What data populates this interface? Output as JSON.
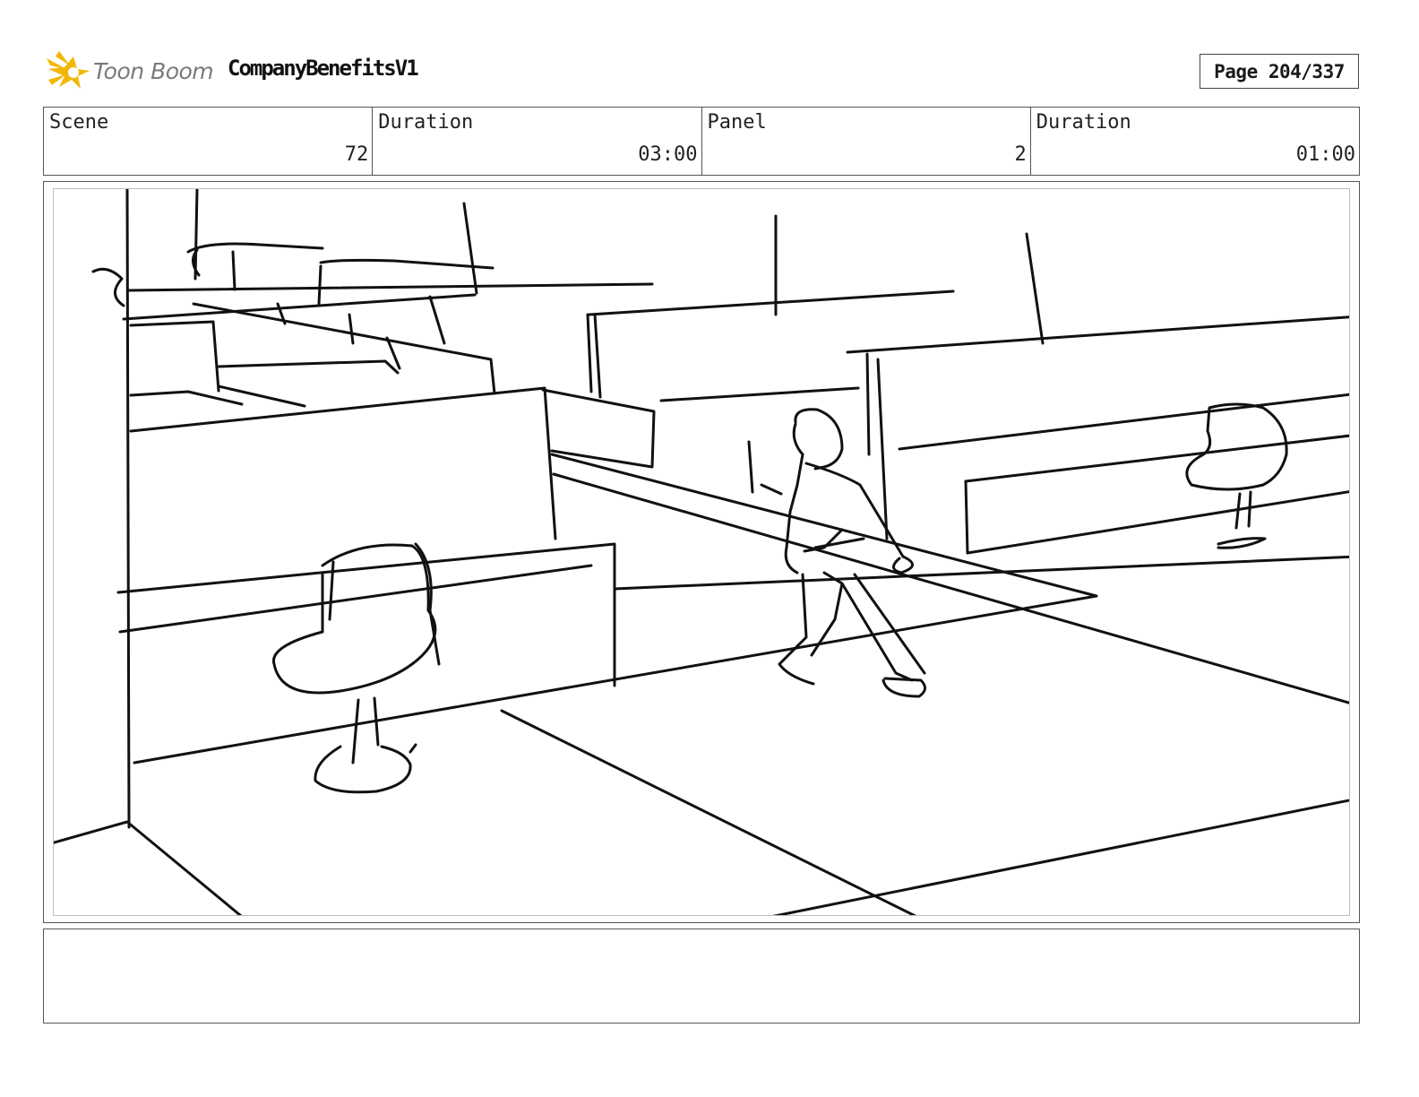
{
  "header": {
    "logo_text": "Toon Boom",
    "project_title": "CompanyBenefitsV1",
    "page_indicator": "Page 204/337"
  },
  "info": {
    "scene_label": "Scene",
    "scene_value": "72",
    "scene_duration_label": "Duration",
    "scene_duration_value": "03:00",
    "panel_label": "Panel",
    "panel_value": "2",
    "panel_duration_label": "Duration",
    "panel_duration_value": "01:00"
  },
  "notes": {
    "text": ""
  },
  "colors": {
    "logo_star": "#f2b705",
    "logo_text": "#7a7a7a",
    "sketch_ink": "#111111",
    "frame_border": "#555555"
  }
}
